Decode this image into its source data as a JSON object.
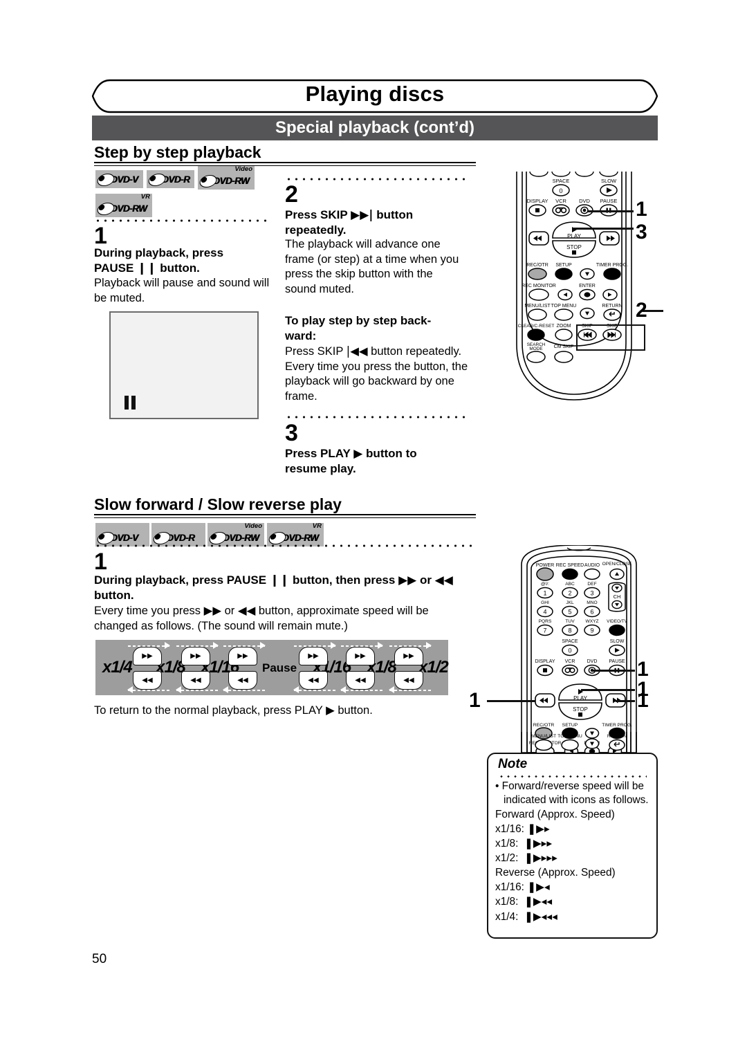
{
  "header": {
    "title": "Playing discs",
    "subtitle": "Special playback (cont’d)"
  },
  "sections": [
    {
      "heading": "Step by step playback",
      "discs": [
        "DVD-V",
        "DVD-R",
        "DVD-RW",
        "DVD-RW"
      ],
      "disc_sups": [
        "",
        "",
        "Video",
        "VR"
      ],
      "steps": [
        {
          "number": "1",
          "bold": "During playback, press PAUSE ‖ button.",
          "body": "Playback will pause and sound will be muted."
        },
        {
          "number": "2",
          "bold": "Press SKIP ▶▶| button repeatedly.",
          "body": "The playback will advance one frame (or step) at a time when you press the skip button with the sound muted.",
          "sub_bold": "To play step by step backward:",
          "sub_body": "Press SKIP |◀◀ button repeatedly. Every time you press the button, the playback will go backward by one frame."
        },
        {
          "number": "3",
          "bold": "Press PLAY ▶ button to resume play."
        }
      ]
    },
    {
      "heading": "Slow forward / Slow reverse play",
      "discs": [
        "DVD-V",
        "DVD-R",
        "DVD-RW",
        "DVD-RW"
      ],
      "disc_sups": [
        "",
        "",
        "Video",
        "VR"
      ],
      "steps": [
        {
          "number": "1",
          "bold": "During playback, press PAUSE ‖ button, then press ▶▶ or ◀◀ button.",
          "body": "Every time you press ▶▶ or ◀◀ button, approximate speed will be changed as follows. (The sound will remain mute.)"
        }
      ],
      "footer_text": "To return to the normal playback, press PLAY ▶ button."
    }
  ],
  "speed_diagram": {
    "labels": [
      "x1/4",
      "x1/8",
      "x1/16",
      "Pause",
      "x1/16",
      "x1/8",
      "x1/2"
    ],
    "forward_glyph": "▸▸",
    "reverse_glyph": "◂◂"
  },
  "note": {
    "title": "Note",
    "bullet": "Forward/reverse speed will be indicated with icons as follows.",
    "forward_title": "Forward (Approx. Speed)",
    "forward_rows": [
      {
        "label": "x1/16:",
        "arrows": 1
      },
      {
        "label": "x1/8:",
        "arrows": 2
      },
      {
        "label": "x1/2:",
        "arrows": 3
      }
    ],
    "reverse_title": "Reverse (Approx. Speed)",
    "reverse_rows": [
      {
        "label": "x1/16:",
        "arrows": 1
      },
      {
        "label": "x1/8:",
        "arrows": 2
      },
      {
        "label": "x1/4:",
        "arrows": 3
      }
    ]
  },
  "remote_top": {
    "callouts": [
      "1",
      "3",
      "2"
    ],
    "button_labels": [
      "SPACE",
      "SLOW",
      "DISPLAY",
      "VCR",
      "DVD",
      "PAUSE",
      "PLAY",
      "STOP",
      "REC/OTR",
      "SETUP",
      "TIMER PROG.",
      "REC MONITOR",
      "ENTER",
      "MENU/LIST",
      "TOP MENU",
      "RETURN",
      "CLEAR/C-RESET",
      "ZOOM",
      "SKIP",
      "SKIP",
      "SEARCH MODE",
      "CM SKIP"
    ],
    "numeric": "0"
  },
  "remote_bottom": {
    "callouts": [
      "1",
      "1",
      "1",
      "1"
    ],
    "button_labels": [
      "POWER",
      "REC SPEED",
      "AUDIO",
      "OPEN/CLOSE",
      "@!/:",
      "ABC",
      "DEF",
      "CH",
      "GHI",
      "JKL",
      "MNO",
      "PQRS",
      "TUV",
      "WXYZ",
      "VIDEO/TV",
      "SPACE",
      "SLOW",
      "DISPLAY",
      "VCR",
      "DVD",
      "PAUSE",
      "PLAY",
      "STOP",
      "REC/OTR",
      "SETUP",
      "TIMER PROG.",
      "REC MONITOR",
      "ENTER",
      "MENU/LIST",
      "TOP MENU",
      "RETURN"
    ],
    "keys": [
      "1",
      "2",
      "3",
      "4",
      "5",
      "6",
      "7",
      "8",
      "9",
      "0"
    ]
  },
  "page_number": "50",
  "colors": {
    "subbar": "#555557",
    "badge_bg": "#b3b3b3",
    "speedbar_bg": "#9d9d9d",
    "screen_bg": "#f2f2f2"
  }
}
